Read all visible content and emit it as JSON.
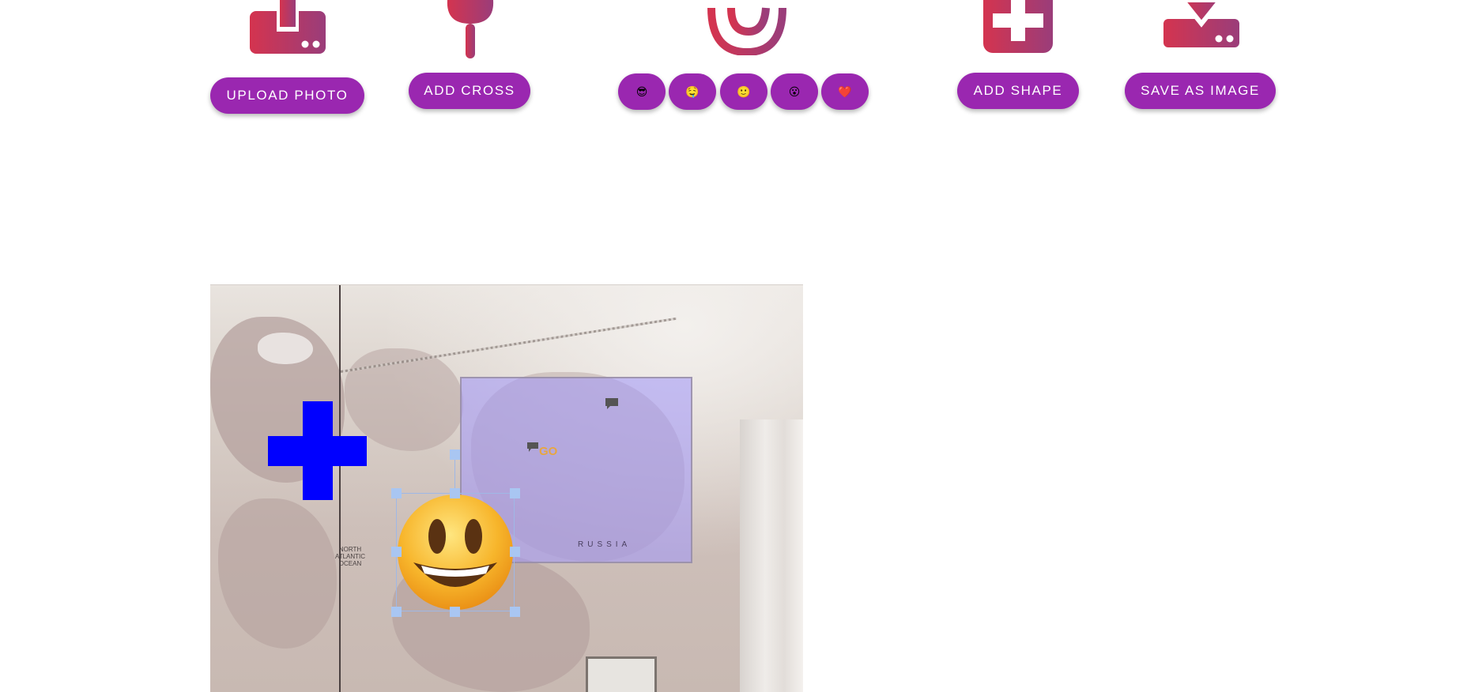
{
  "toolbar": {
    "upload_label": "Upload photo",
    "cross_label": "Add cross",
    "shape_label": "Add shape",
    "save_label": "Save as image",
    "emojis": [
      "😎",
      "🤤",
      "🙂",
      "😮",
      "❤️"
    ]
  },
  "icons": {
    "upload": "upload-icon",
    "pin": "pin-icon",
    "at": "at-sign-icon",
    "add_shape": "plus-square-icon",
    "download": "download-icon"
  },
  "canvas": {
    "text_label": "GO",
    "map_label_russia": "RUSSIA",
    "map_label_ocean": "NORTH ATLANTIC OCEAN",
    "selected_emoji": "😃"
  },
  "colors": {
    "button": "#9a27b0",
    "icon_gradient_start": "#d4344f",
    "icon_gradient_end": "#9a3d7a",
    "cross": "#0000ff",
    "shape_fill": "#a096fa",
    "text_label": "#e8a640",
    "selection_handle": "#a9c6f2"
  }
}
